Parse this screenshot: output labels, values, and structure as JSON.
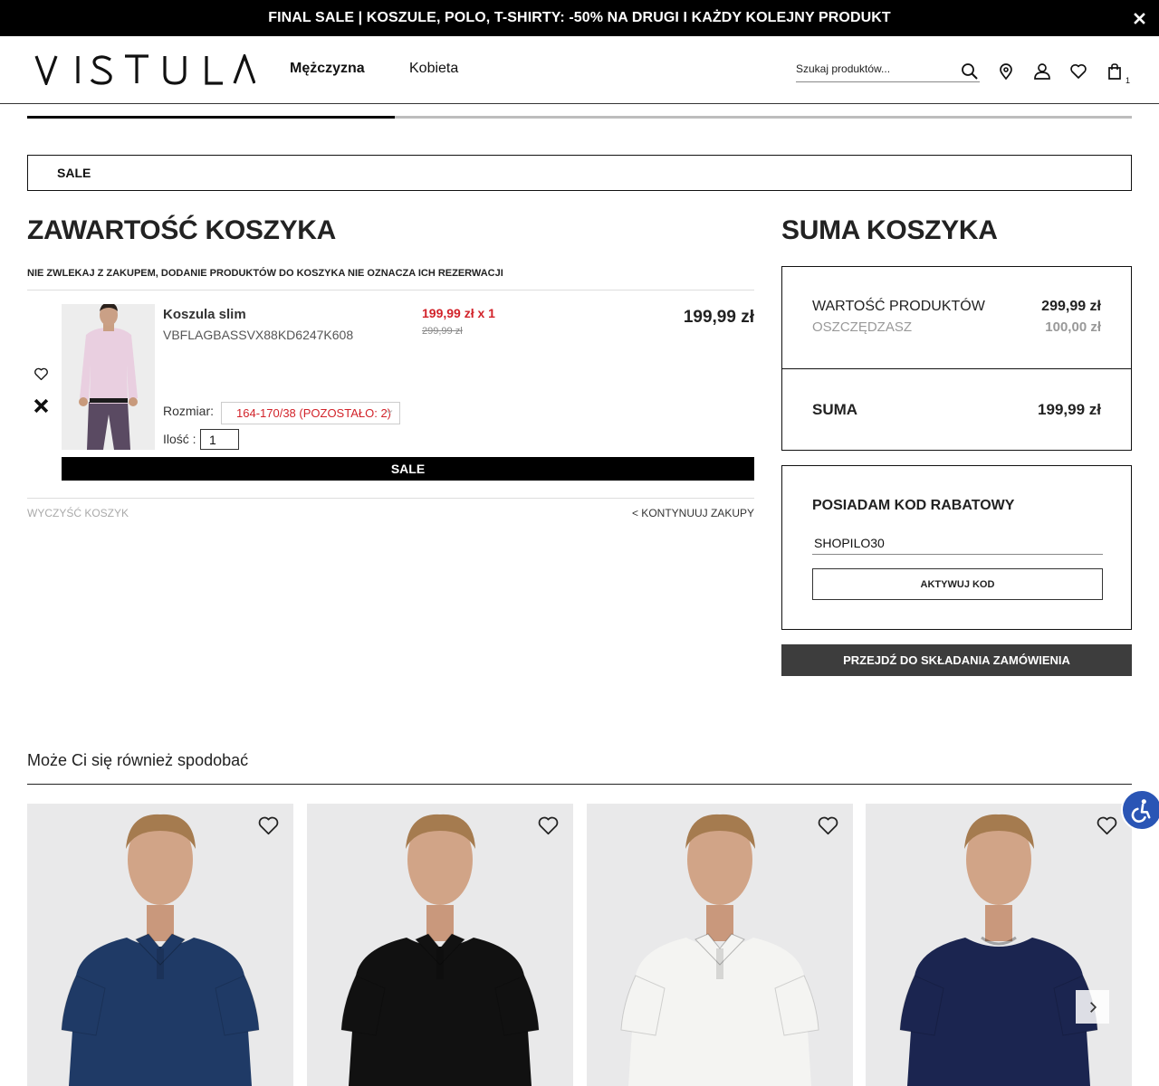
{
  "promo": {
    "text": "FINAL SALE | KOSZULE, POLO, T-SHIRTY: -50% NA DRUGI I KAŻDY KOLEJNY PRODUKT"
  },
  "header": {
    "brand": "VISTULA",
    "nav": [
      "Mężczyzna",
      "Kobieta"
    ],
    "search_placeholder": "Szukaj produktów...",
    "cart_count": "1"
  },
  "sale_banner": "SALE",
  "cart": {
    "title": "ZAWARTOŚĆ KOSZYKA",
    "notice": "NIE ZWLEKAJ Z ZAKUPEM, DODANIE PRODUKTÓW DO KOSZYKA NIE OZNACZA ICH REZERWACJI",
    "item": {
      "name": "Koszula slim",
      "sku": "VBFLAGBASSVX88KD6247K608",
      "price": "199,99 zł x 1",
      "old_price": "299,99 zł",
      "total": "199,99 zł",
      "size_label": "Rozmiar:",
      "size_value": "164-170/38 (POZOSTAŁO: 2)",
      "qty_label": "Ilość :",
      "qty": "1",
      "badge": "SALE"
    },
    "clear": "WYCZYŚĆ KOSZYK",
    "continue": "< KONTYNUUJ ZAKUPY"
  },
  "summary": {
    "title": "SUMA KOSZYKA",
    "products_label": "WARTOŚĆ PRODUKTÓW",
    "products_value": "299,99 zł",
    "savings_label": "OSZCZĘDZASZ",
    "savings_value": "100,00 zł",
    "total_label": "SUMA",
    "total_value": "199,99 zł"
  },
  "discount": {
    "title": "POSIADAM KOD RABATOWY",
    "code": "SHOPILO30",
    "button": "AKTYWUJ KOD"
  },
  "checkout_button": "PRZEJDŹ DO SKŁADANIA ZAMÓWIENIA",
  "recommendations": {
    "title": "Może Ci się również spodobać",
    "items": [
      {
        "shirt_color": "#1f3a66",
        "type": "polo"
      },
      {
        "shirt_color": "#111111",
        "type": "polo"
      },
      {
        "shirt_color": "#f4f4f2",
        "type": "polo"
      },
      {
        "shirt_color": "#1b2550",
        "type": "tshirt"
      }
    ]
  },
  "colors": {
    "accent_red": "#d2232a",
    "checkout_bg": "#3d3d3d",
    "accessibility_blue": "#2a55b5"
  }
}
